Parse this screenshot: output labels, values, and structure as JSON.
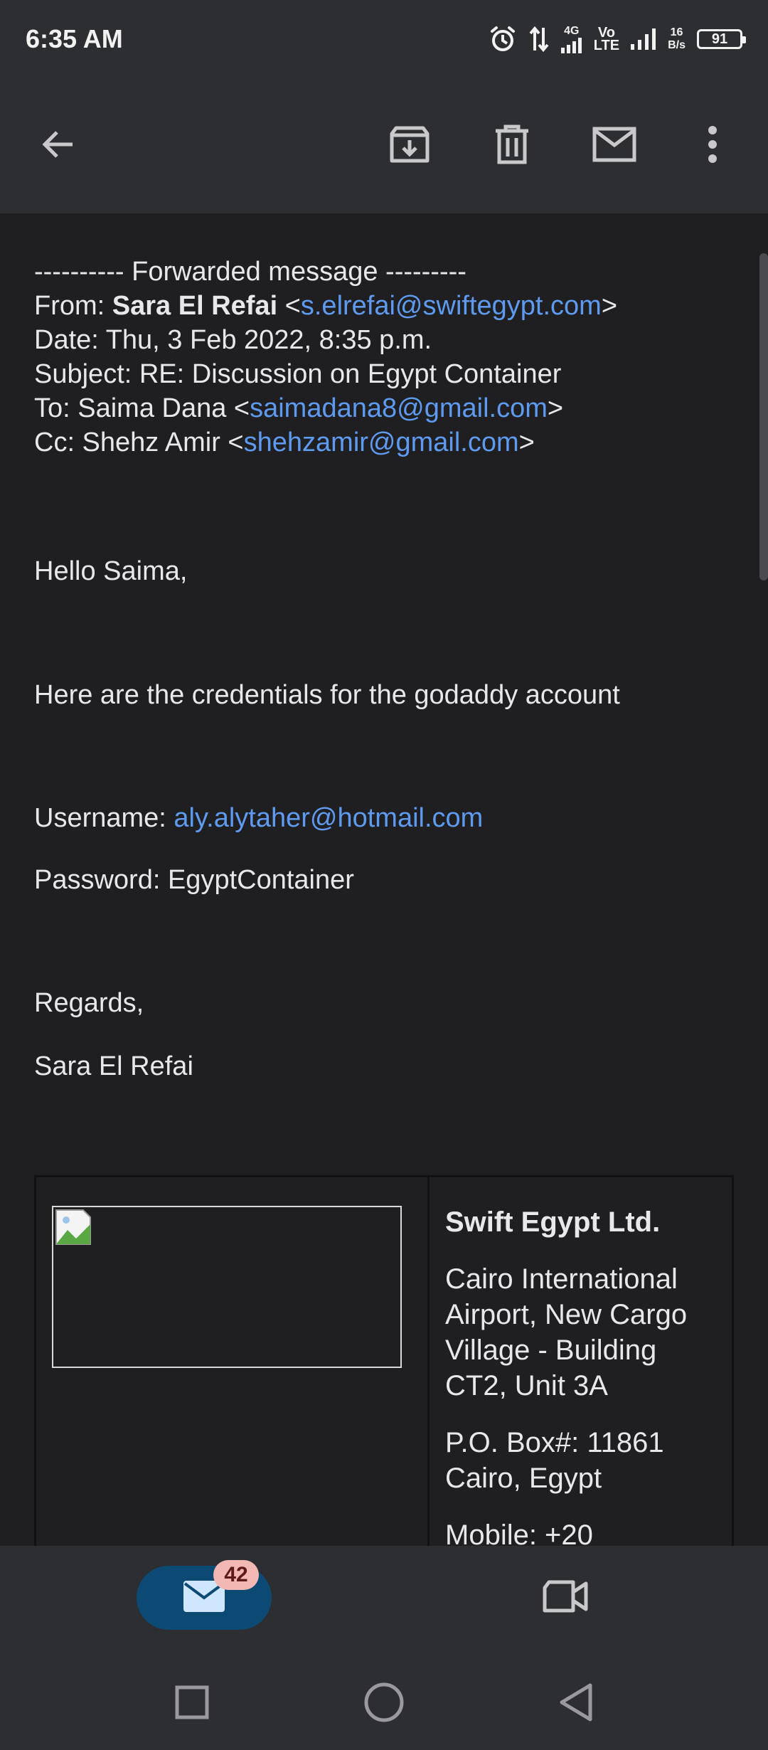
{
  "status_bar": {
    "time": "6:35 AM",
    "net_top": "4G",
    "volte_top": "Vo",
    "volte_bottom": "LTE",
    "speed_top": "16",
    "speed_bottom": "B/s",
    "battery": "91"
  },
  "toolbar": {
    "icons": [
      "back-arrow-icon",
      "archive-icon",
      "delete-icon",
      "mark-unread-icon",
      "more-vert-icon"
    ]
  },
  "email": {
    "forward_header": "---------- Forwarded message ---------",
    "from_label": "From: ",
    "from_name": "Sara El Refai",
    "from_email": "s.elrefai@swiftegypt.com",
    "date_line": "Date: Thu, 3 Feb 2022, 8:35 p.m.",
    "subject_line": "Subject: RE: Discussion on Egypt Container",
    "to_label": "To: Saima Dana <",
    "to_email": "saimadana8@gmail.com",
    "cc_label": "Cc: Shehz Amir <",
    "cc_email": "shehzamir@gmail.com",
    "greeting": "Hello Saima,",
    "body": "Here are the credentials for the godaddy account",
    "username_label": "Username: ",
    "username_value": "aly.alytaher@hotmail.com",
    "password_line": "Password: EgyptContainer",
    "regards": "Regards,",
    "signoff_name": "Sara El Refai"
  },
  "signature": {
    "company": "Swift Egypt Ltd.",
    "address_1": "Cairo International",
    "address_2": "Airport, New Cargo",
    "address_3": "Village - Building",
    "address_4": "CT2, Unit 3A",
    "po_box": "P.O. Box#: 11861",
    "city": "Cairo, Egypt",
    "mobile_partial": "Mobile: +20"
  },
  "bottom_nav": {
    "mail_badge": "42"
  }
}
